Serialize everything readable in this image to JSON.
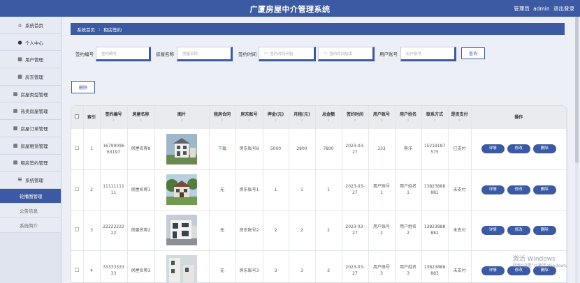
{
  "header": {
    "title": "广厦房屋中介管理系统",
    "role": "管理员",
    "username": "admin",
    "logout": "退出登录"
  },
  "sidebar": {
    "items": [
      {
        "label": "系统首页",
        "icon": "home-icon"
      },
      {
        "label": "个人中心",
        "icon": "user-icon"
      },
      {
        "label": "用户管理",
        "icon": "grid-icon"
      },
      {
        "label": "房东管理",
        "icon": "grid-icon"
      },
      {
        "label": "房屋类型管理",
        "icon": "grid-icon"
      },
      {
        "label": "热卖房屋管理",
        "icon": "grid-icon"
      },
      {
        "label": "房屋订单管理",
        "icon": "grid-icon"
      },
      {
        "label": "房屋租赁管理",
        "icon": "grid-icon"
      },
      {
        "label": "租房签约管理",
        "icon": "grid-icon"
      },
      {
        "label": "系统管理",
        "icon": "menu-icon"
      }
    ],
    "subitems": [
      {
        "label": "轮播图管理"
      },
      {
        "label": "公告信息"
      },
      {
        "label": "系统简介"
      }
    ]
  },
  "breadcrumb": {
    "home": "系统首页",
    "separator": "⁝",
    "current": "租房签约"
  },
  "search": {
    "fields": [
      {
        "label": "签约编号",
        "placeholder": "签约编号"
      },
      {
        "label": "房屋名称",
        "placeholder": "房屋名称"
      },
      {
        "label": "签约时间",
        "placeholder_start": "签约时间开始",
        "placeholder_end": "签约时间结束"
      },
      {
        "label": "用户账号",
        "placeholder": "用户账号"
      }
    ],
    "button": "查询"
  },
  "delete_button": "删除",
  "table": {
    "columns": [
      "索引",
      "签约编号",
      "房屋名称",
      "图片",
      "租房合同",
      "房东账号",
      "押金(元)",
      "月租(元)",
      "总金额",
      "签约时间",
      "用户账号",
      "用户姓名",
      "联系方式",
      "是否支付",
      "操作"
    ],
    "sort_glyph": "↕",
    "actions": {
      "detail": "详情",
      "edit": "修改",
      "delete": "删除"
    },
    "rows": [
      {
        "index": "1",
        "contract_no": "1679909663197",
        "house_name": "房屋名称8",
        "contract": "下载",
        "landlord": "房东账号8",
        "deposit": "5000",
        "rent": "2800",
        "total": "7800",
        "sign_time": "2023-03-27",
        "user_account": "333",
        "user_name": "熊洋",
        "phone": "15219187575",
        "paid": "已支付"
      },
      {
        "index": "2",
        "contract_no": "1111111111",
        "house_name": "房屋名称1",
        "contract": "无",
        "landlord": "房东账号1",
        "deposit": "1",
        "rent": "1",
        "total": "1",
        "sign_time": "2023-03-27",
        "user_account": "用户账号1",
        "user_name": "用户姓名1",
        "phone": "13823888881",
        "paid": "未支付"
      },
      {
        "index": "3",
        "contract_no": "2222222222",
        "house_name": "房屋名称2",
        "contract": "无",
        "landlord": "房东账号2",
        "deposit": "2",
        "rent": "2",
        "total": "2",
        "sign_time": "2023-03-27",
        "user_account": "用户账号2",
        "user_name": "用户姓名2",
        "phone": "13823888882",
        "paid": "未支付"
      },
      {
        "index": "4",
        "contract_no": "3333333333",
        "house_name": "房屋名称3",
        "contract": "无",
        "landlord": "房东账号3",
        "deposit": "3",
        "rent": "3",
        "total": "3",
        "sign_time": "2023-03-27",
        "user_account": "用户账号3",
        "user_name": "用户姓名3",
        "phone": "13823888883",
        "paid": "未支付"
      }
    ]
  },
  "watermark": {
    "line1": "激活 Windows",
    "line2": "转到\"设置\"以激活 Windows。"
  },
  "colors": {
    "primary": "#3b5aa3",
    "page_bg": "#eceff5"
  }
}
